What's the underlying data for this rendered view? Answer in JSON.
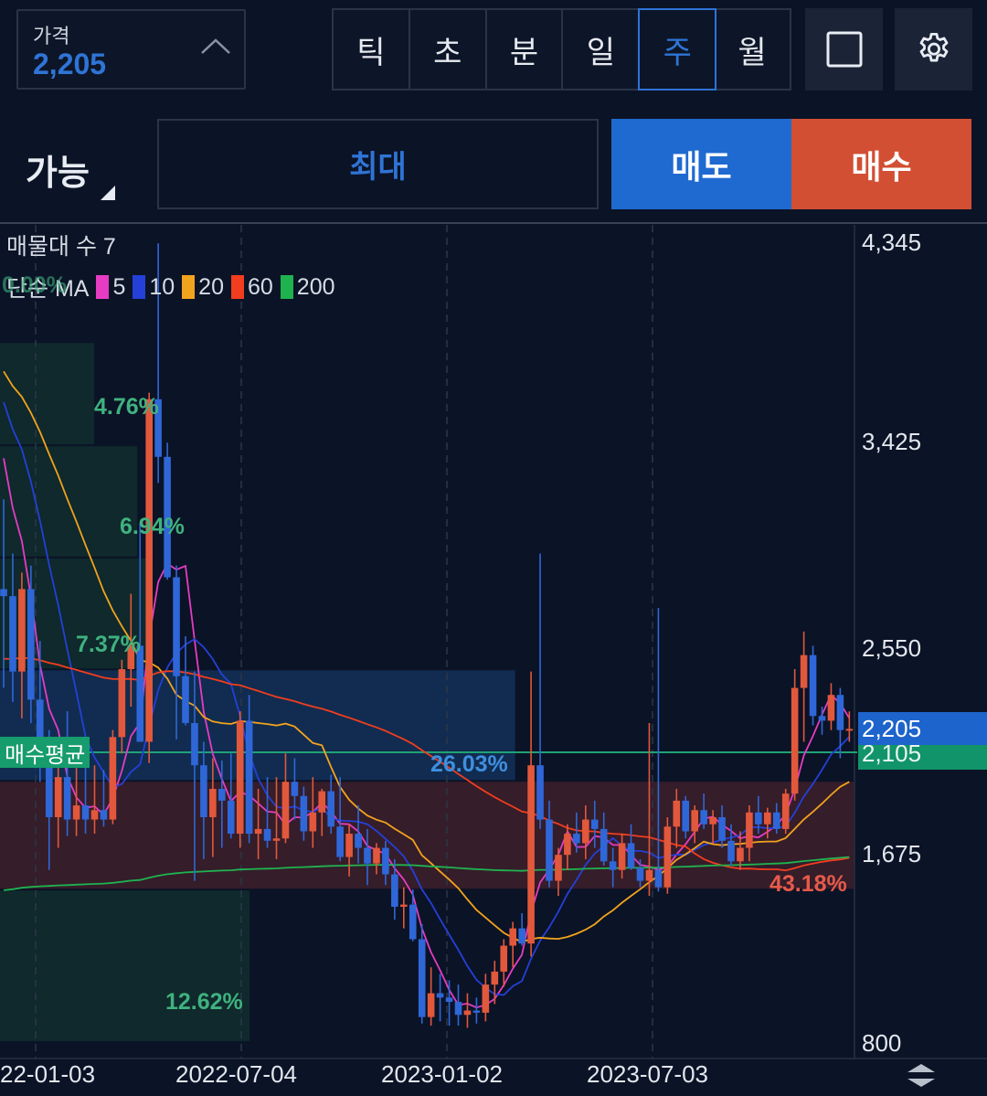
{
  "header": {
    "price_label": "가격",
    "price_value": "2,205",
    "periods": [
      {
        "label": "틱",
        "active": false
      },
      {
        "label": "초",
        "active": false
      },
      {
        "label": "분",
        "active": false
      },
      {
        "label": "일",
        "active": false
      },
      {
        "label": "주",
        "active": true
      },
      {
        "label": "월",
        "active": false
      }
    ],
    "icons": {
      "fullscreen": "square-icon",
      "settings": "gear-icon",
      "collapse": "chevron-up-icon"
    }
  },
  "order": {
    "type_label": "가능",
    "quantity_label": "최대",
    "sell_label": "매도",
    "buy_label": "매수"
  },
  "colors": {
    "background": "#0b1326",
    "accent_blue": "#2f74d6",
    "sell": "#1f6ad1",
    "buy": "#d24f33",
    "up_candle": "#e2583c",
    "down_candle": "#2f67d8",
    "avg_line": "#169c6d"
  },
  "chart_data": {
    "type": "candlestick",
    "period": "weekly",
    "legend": {
      "volume_profile": "매물대 수 7",
      "ma_label": "단순 MA",
      "ma_periods": [
        {
          "period": "5",
          "color": "#e63cc4"
        },
        {
          "period": "10",
          "color": "#2440d8"
        },
        {
          "period": "20",
          "color": "#f2a31d"
        },
        {
          "period": "60",
          "color": "#f23d1e"
        },
        {
          "period": "200",
          "color": "#1fb34f"
        }
      ]
    },
    "y_ticks": [
      "4,345",
      "3,425",
      "2,550",
      "2,105",
      "1,675",
      "800"
    ],
    "x_ticks": [
      "22-01-03",
      "2022-07-04",
      "2023-01-02",
      "2023-07-03"
    ],
    "ylim": [
      800,
      4345
    ],
    "current_price": "2,205",
    "buy_average": {
      "label": "매수평균",
      "value": 2105
    },
    "volume_profile": [
      {
        "pct": "0.00%",
        "low": 3880,
        "high": 4345
      },
      {
        "pct": "4.76%",
        "low": 3405,
        "high": 3880
      },
      {
        "pct": "6.94%",
        "low": 2930,
        "high": 3405
      },
      {
        "pct": "7.37%",
        "low": 2455,
        "high": 2930
      },
      {
        "pct": "26.03%",
        "low": 1980,
        "high": 2455
      },
      {
        "pct": "43.18%",
        "low": 1505,
        "high": 1980
      },
      {
        "pct": "12.62%",
        "low": 800,
        "high": 1505
      }
    ],
    "candles": [
      [
        2800,
        3180,
        2380,
        2770
      ],
      [
        2770,
        2950,
        2320,
        2450
      ],
      [
        2450,
        2870,
        2250,
        2800
      ],
      [
        2800,
        2900,
        2230,
        2330
      ],
      [
        2330,
        2580,
        1980,
        2040
      ],
      [
        2040,
        2200,
        1600,
        1830
      ],
      [
        1830,
        2150,
        1700,
        2000
      ],
      [
        2000,
        2280,
        1750,
        1820
      ],
      [
        1820,
        2080,
        1750,
        1880
      ],
      [
        1880,
        2150,
        1760,
        1820
      ],
      [
        1820,
        2050,
        1760,
        1860
      ],
      [
        1860,
        2030,
        1790,
        1820
      ],
      [
        1820,
        2200,
        1800,
        2170
      ],
      [
        2170,
        2500,
        2100,
        2460
      ],
      [
        2460,
        2780,
        2300,
        2560
      ],
      [
        2560,
        3080,
        2150,
        2150
      ],
      [
        2150,
        3650,
        2060,
        3620
      ],
      [
        3620,
        4340,
        3250,
        3360
      ],
      [
        3360,
        3420,
        2840,
        2850
      ],
      [
        2850,
        2900,
        2160,
        2430
      ],
      [
        2430,
        2600,
        2220,
        2230
      ],
      [
        2230,
        2450,
        1550,
        2050
      ],
      [
        2050,
        2150,
        1650,
        1830
      ],
      [
        1830,
        2080,
        1660,
        1950
      ],
      [
        1950,
        2070,
        1700,
        1900
      ],
      [
        1900,
        2100,
        1740,
        1760
      ],
      [
        1760,
        2280,
        1700,
        2240
      ],
      [
        2240,
        2350,
        1720,
        1760
      ],
      [
        1760,
        1950,
        1650,
        1780
      ],
      [
        1780,
        2000,
        1700,
        1730
      ],
      [
        1730,
        2000,
        1650,
        1740
      ],
      [
        1740,
        2100,
        1720,
        1980
      ],
      [
        1980,
        2080,
        1820,
        1920
      ],
      [
        1920,
        1960,
        1730,
        1770
      ],
      [
        1770,
        2000,
        1700,
        1850
      ],
      [
        1850,
        1950,
        1750,
        1940
      ],
      [
        1940,
        2010,
        1760,
        1790
      ],
      [
        1790,
        2000,
        1640,
        1660
      ],
      [
        1660,
        1800,
        1570,
        1760
      ],
      [
        1760,
        1880,
        1630,
        1700
      ],
      [
        1700,
        1780,
        1530,
        1630
      ],
      [
        1630,
        1720,
        1580,
        1700
      ],
      [
        1700,
        1730,
        1530,
        1580
      ],
      [
        1580,
        1650,
        1370,
        1430
      ],
      [
        1430,
        1520,
        1330,
        1440
      ],
      [
        1440,
        1510,
        1270,
        1280
      ],
      [
        1280,
        1350,
        890,
        920
      ],
      [
        920,
        1150,
        880,
        1030
      ],
      [
        1030,
        1120,
        900,
        1010
      ],
      [
        1010,
        1090,
        880,
        990
      ],
      [
        990,
        1070,
        880,
        930
      ],
      [
        930,
        1030,
        870,
        950
      ],
      [
        950,
        1010,
        890,
        940
      ],
      [
        940,
        1120,
        900,
        1070
      ],
      [
        1070,
        1180,
        980,
        1130
      ],
      [
        1130,
        1280,
        1060,
        1250
      ],
      [
        1250,
        1360,
        1150,
        1330
      ],
      [
        1330,
        1400,
        1250,
        1260
      ],
      [
        1260,
        2450,
        1200,
        2050
      ],
      [
        2050,
        2950,
        1780,
        1820
      ],
      [
        1820,
        1900,
        1520,
        1550
      ],
      [
        1550,
        1700,
        1480,
        1670
      ],
      [
        1670,
        1800,
        1600,
        1760
      ],
      [
        1760,
        1850,
        1680,
        1720
      ],
      [
        1720,
        1880,
        1650,
        1820
      ],
      [
        1820,
        1900,
        1700,
        1780
      ],
      [
        1780,
        1850,
        1620,
        1640
      ],
      [
        1640,
        1700,
        1520,
        1600
      ],
      [
        1600,
        1760,
        1560,
        1720
      ],
      [
        1720,
        1800,
        1600,
        1610
      ],
      [
        1610,
        1650,
        1520,
        1550
      ],
      [
        1550,
        2230,
        1480,
        1600
      ],
      [
        1600,
        2720,
        1500,
        1520
      ],
      [
        1520,
        1830,
        1490,
        1790
      ],
      [
        1790,
        1950,
        1700,
        1900
      ],
      [
        1900,
        1920,
        1740,
        1770
      ],
      [
        1770,
        1880,
        1720,
        1860
      ],
      [
        1860,
        1930,
        1780,
        1800
      ],
      [
        1800,
        1860,
        1720,
        1830
      ],
      [
        1830,
        1880,
        1700,
        1730
      ],
      [
        1730,
        1800,
        1620,
        1640
      ],
      [
        1640,
        1770,
        1600,
        1700
      ],
      [
        1700,
        1880,
        1640,
        1850
      ],
      [
        1850,
        1920,
        1760,
        1800
      ],
      [
        1800,
        1870,
        1740,
        1850
      ],
      [
        1850,
        1890,
        1760,
        1780
      ],
      [
        1780,
        1950,
        1760,
        1930
      ],
      [
        1930,
        2460,
        1900,
        2380
      ],
      [
        2380,
        2620,
        2150,
        2520
      ],
      [
        2520,
        2560,
        2220,
        2260
      ],
      [
        2260,
        2300,
        2180,
        2240
      ],
      [
        2240,
        2400,
        2200,
        2350
      ],
      [
        2350,
        2380,
        2080,
        2200
      ],
      [
        2200,
        2280,
        2150,
        2205
      ]
    ]
  }
}
